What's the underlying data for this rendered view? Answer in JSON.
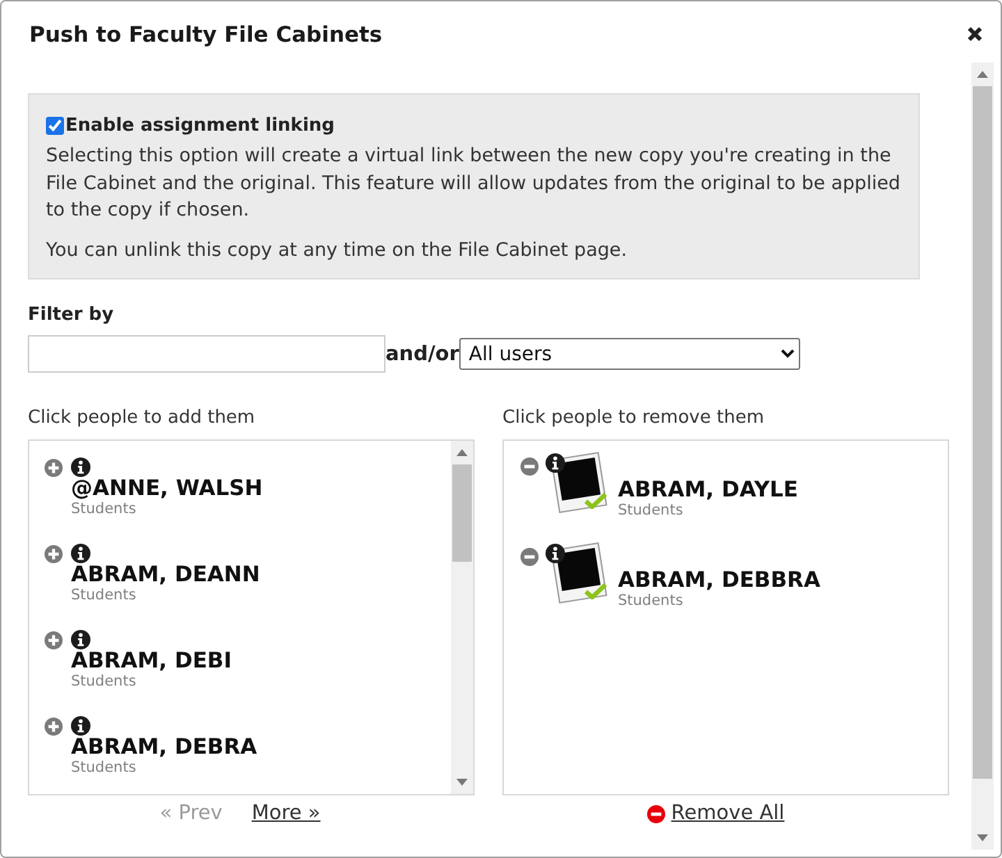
{
  "dialog": {
    "title": "Push to Faculty File Cabinets"
  },
  "linking": {
    "checked": true,
    "label": "Enable assignment linking",
    "description": "Selecting this option will create a virtual link between the new copy you're creating in the File Cabinet and the original. This feature will allow updates from the original to be applied to the copy if chosen.",
    "note": "You can unlink this copy at any time on the File Cabinet page."
  },
  "filter": {
    "label": "Filter by",
    "joiner": "and/or",
    "user_type": "All users"
  },
  "available": {
    "heading": "Click people to add them",
    "people": [
      {
        "name": "@ANNE, WALSH",
        "group": "Students"
      },
      {
        "name": "ABRAM, DEANN",
        "group": "Students"
      },
      {
        "name": "ABRAM, DEBI",
        "group": "Students"
      },
      {
        "name": "ABRAM, DEBRA",
        "group": "Students"
      }
    ],
    "pager": [
      {
        "label": "« Prev",
        "disabled": true
      },
      {
        "label": "More »",
        "disabled": false
      }
    ]
  },
  "chosen": {
    "heading": "Click people to remove them",
    "people": [
      {
        "name": "ABRAM, DAYLE",
        "group": "Students"
      },
      {
        "name": "ABRAM, DEBBRA",
        "group": "Students"
      }
    ],
    "remove_all": "Remove All"
  }
}
